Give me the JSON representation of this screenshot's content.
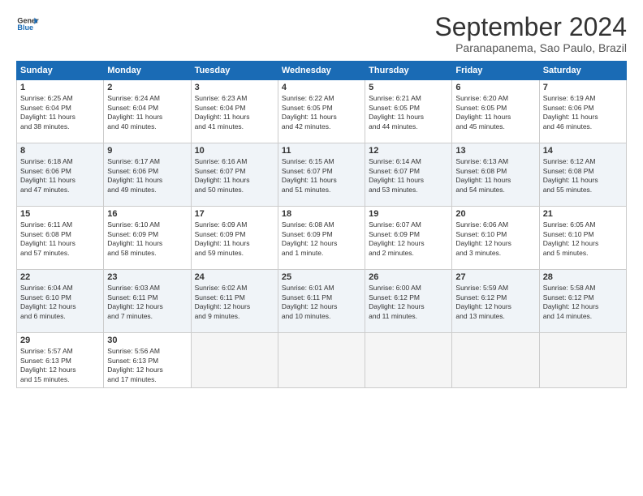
{
  "header": {
    "logo_line1": "General",
    "logo_line2": "Blue",
    "month_title": "September 2024",
    "location": "Paranapanema, Sao Paulo, Brazil"
  },
  "days_of_week": [
    "Sunday",
    "Monday",
    "Tuesday",
    "Wednesday",
    "Thursday",
    "Friday",
    "Saturday"
  ],
  "weeks": [
    [
      {
        "day": "1",
        "sunrise": "6:25 AM",
        "sunset": "6:04 PM",
        "daylight": "11 hours and 38 minutes."
      },
      {
        "day": "2",
        "sunrise": "6:24 AM",
        "sunset": "6:04 PM",
        "daylight": "11 hours and 40 minutes."
      },
      {
        "day": "3",
        "sunrise": "6:23 AM",
        "sunset": "6:04 PM",
        "daylight": "11 hours and 41 minutes."
      },
      {
        "day": "4",
        "sunrise": "6:22 AM",
        "sunset": "6:05 PM",
        "daylight": "11 hours and 42 minutes."
      },
      {
        "day": "5",
        "sunrise": "6:21 AM",
        "sunset": "6:05 PM",
        "daylight": "11 hours and 44 minutes."
      },
      {
        "day": "6",
        "sunrise": "6:20 AM",
        "sunset": "6:05 PM",
        "daylight": "11 hours and 45 minutes."
      },
      {
        "day": "7",
        "sunrise": "6:19 AM",
        "sunset": "6:06 PM",
        "daylight": "11 hours and 46 minutes."
      }
    ],
    [
      {
        "day": "8",
        "sunrise": "6:18 AM",
        "sunset": "6:06 PM",
        "daylight": "11 hours and 47 minutes."
      },
      {
        "day": "9",
        "sunrise": "6:17 AM",
        "sunset": "6:06 PM",
        "daylight": "11 hours and 49 minutes."
      },
      {
        "day": "10",
        "sunrise": "6:16 AM",
        "sunset": "6:07 PM",
        "daylight": "11 hours and 50 minutes."
      },
      {
        "day": "11",
        "sunrise": "6:15 AM",
        "sunset": "6:07 PM",
        "daylight": "11 hours and 51 minutes."
      },
      {
        "day": "12",
        "sunrise": "6:14 AM",
        "sunset": "6:07 PM",
        "daylight": "11 hours and 53 minutes."
      },
      {
        "day": "13",
        "sunrise": "6:13 AM",
        "sunset": "6:08 PM",
        "daylight": "11 hours and 54 minutes."
      },
      {
        "day": "14",
        "sunrise": "6:12 AM",
        "sunset": "6:08 PM",
        "daylight": "11 hours and 55 minutes."
      }
    ],
    [
      {
        "day": "15",
        "sunrise": "6:11 AM",
        "sunset": "6:08 PM",
        "daylight": "11 hours and 57 minutes."
      },
      {
        "day": "16",
        "sunrise": "6:10 AM",
        "sunset": "6:09 PM",
        "daylight": "11 hours and 58 minutes."
      },
      {
        "day": "17",
        "sunrise": "6:09 AM",
        "sunset": "6:09 PM",
        "daylight": "11 hours and 59 minutes."
      },
      {
        "day": "18",
        "sunrise": "6:08 AM",
        "sunset": "6:09 PM",
        "daylight": "12 hours and 1 minute."
      },
      {
        "day": "19",
        "sunrise": "6:07 AM",
        "sunset": "6:09 PM",
        "daylight": "12 hours and 2 minutes."
      },
      {
        "day": "20",
        "sunrise": "6:06 AM",
        "sunset": "6:10 PM",
        "daylight": "12 hours and 3 minutes."
      },
      {
        "day": "21",
        "sunrise": "6:05 AM",
        "sunset": "6:10 PM",
        "daylight": "12 hours and 5 minutes."
      }
    ],
    [
      {
        "day": "22",
        "sunrise": "6:04 AM",
        "sunset": "6:10 PM",
        "daylight": "12 hours and 6 minutes."
      },
      {
        "day": "23",
        "sunrise": "6:03 AM",
        "sunset": "6:11 PM",
        "daylight": "12 hours and 7 minutes."
      },
      {
        "day": "24",
        "sunrise": "6:02 AM",
        "sunset": "6:11 PM",
        "daylight": "12 hours and 9 minutes."
      },
      {
        "day": "25",
        "sunrise": "6:01 AM",
        "sunset": "6:11 PM",
        "daylight": "12 hours and 10 minutes."
      },
      {
        "day": "26",
        "sunrise": "6:00 AM",
        "sunset": "6:12 PM",
        "daylight": "12 hours and 11 minutes."
      },
      {
        "day": "27",
        "sunrise": "5:59 AM",
        "sunset": "6:12 PM",
        "daylight": "12 hours and 13 minutes."
      },
      {
        "day": "28",
        "sunrise": "5:58 AM",
        "sunset": "6:12 PM",
        "daylight": "12 hours and 14 minutes."
      }
    ],
    [
      {
        "day": "29",
        "sunrise": "5:57 AM",
        "sunset": "6:13 PM",
        "daylight": "12 hours and 15 minutes."
      },
      {
        "day": "30",
        "sunrise": "5:56 AM",
        "sunset": "6:13 PM",
        "daylight": "12 hours and 17 minutes."
      },
      null,
      null,
      null,
      null,
      null
    ]
  ]
}
